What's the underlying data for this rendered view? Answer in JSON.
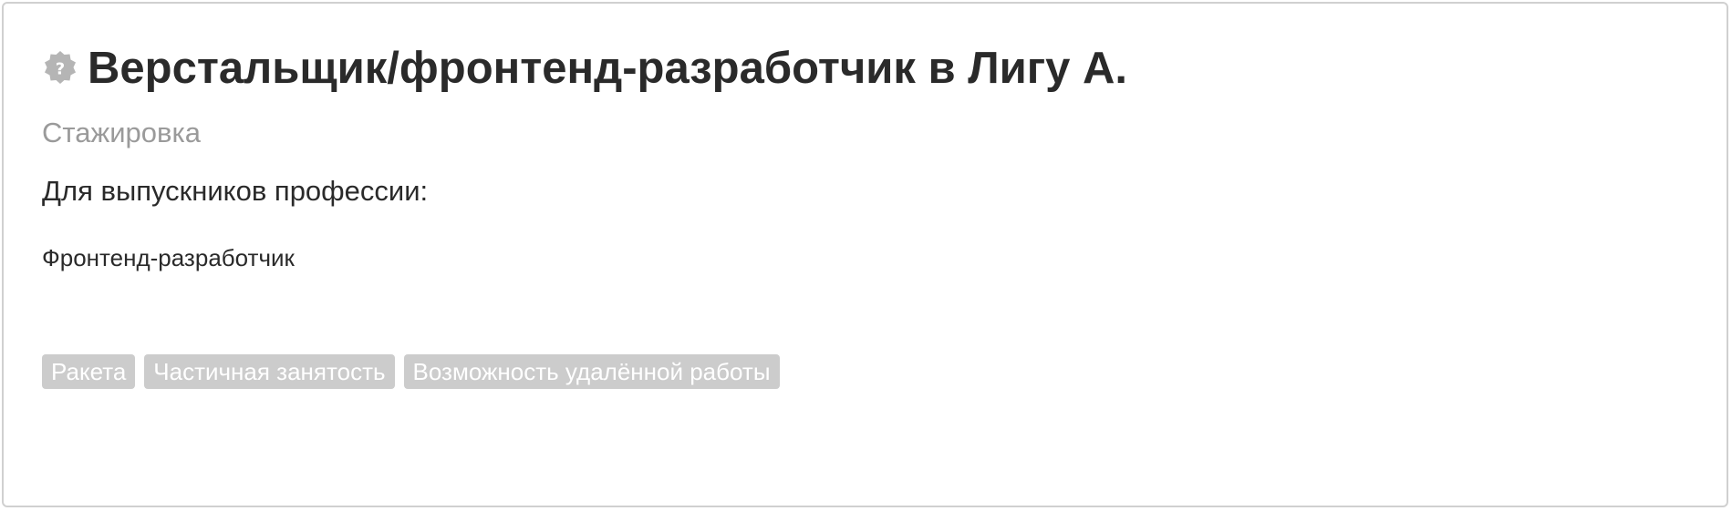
{
  "vacancy": {
    "icon": "question-badge-icon",
    "title": "Верстальщик/фронтенд-разработчик в Лигу А.",
    "type": "Стажировка",
    "for_graduates_label": "Для выпускников профессии:",
    "profession": "Фронтенд-разработчик",
    "tags": [
      {
        "label": "Ракета"
      },
      {
        "label": "Частичная занятость"
      },
      {
        "label": "Возможность удалённой работы"
      }
    ]
  },
  "colors": {
    "title": "#2a2a2a",
    "muted": "#9a9a9a",
    "tag_bg": "#cccccc",
    "tag_text": "#ffffff",
    "icon": "#b5b5b5",
    "border": "#d0d0d0"
  }
}
